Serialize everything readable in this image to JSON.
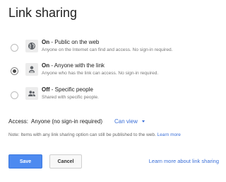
{
  "dialog": {
    "title": "Link sharing"
  },
  "options": [
    {
      "state": "On",
      "label": "Public on the web",
      "description": "Anyone on the Internet can find and access. No sign-in required.",
      "icon": "globe-icon",
      "selected": false
    },
    {
      "state": "On",
      "label": "Anyone with the link",
      "description": "Anyone who has the link can access. No sign-in required.",
      "icon": "link-user-icon",
      "selected": true
    },
    {
      "state": "Off",
      "label": "Specific people",
      "description": "Shared with specific people.",
      "icon": "people-icon",
      "selected": false
    }
  ],
  "access": {
    "label": "Access:",
    "value": "Anyone (no sign-in required)",
    "permission": "Can view"
  },
  "note": {
    "text": "Note: Items with any link sharing option can still be published to the web.",
    "link": "Learn more"
  },
  "buttons": {
    "save": "Save",
    "cancel": "Cancel"
  },
  "learn_more_sharing": "Learn more about link sharing",
  "colors": {
    "accent": "#4d8af0",
    "link": "#3a6fd8"
  }
}
